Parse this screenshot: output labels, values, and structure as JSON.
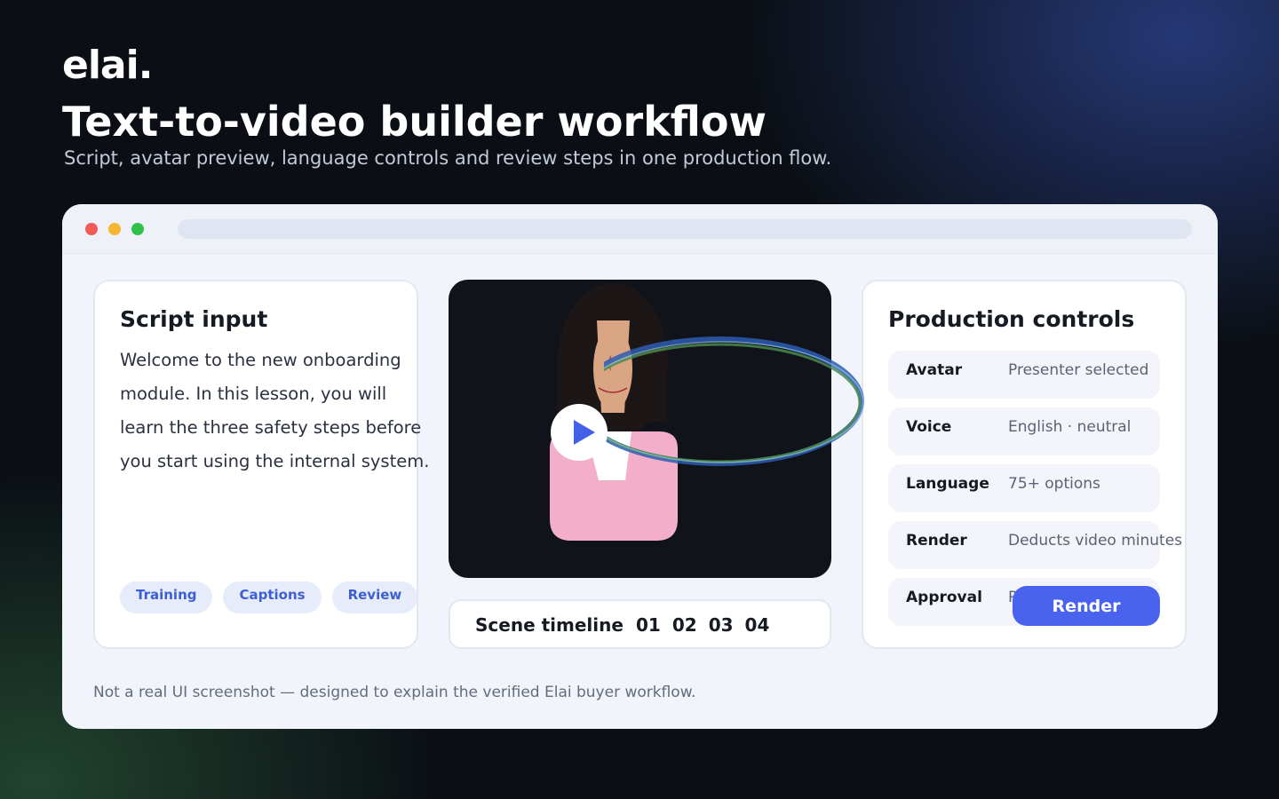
{
  "brand": {
    "logo_text": "elai."
  },
  "header": {
    "title": "Text-to-video builder workflow",
    "subtitle": "Script, avatar preview, language controls and review steps in one production flow."
  },
  "script_panel": {
    "title": "Script input",
    "lines": [
      "Welcome to the new onboarding",
      "module. In this lesson, you will",
      "learn the three safety steps before",
      "you start using the internal system."
    ],
    "tags": [
      "Training",
      "Captions",
      "Review"
    ]
  },
  "preview": {
    "avatar_icon": "presenter-avatar",
    "play_icon": "play-icon",
    "colors": {
      "background": "#10131a",
      "shirt": "#f3afc9",
      "hair": "#1c1616",
      "skin": "#d9a583",
      "play": "#4360e8"
    }
  },
  "timeline": {
    "label": "Scene timeline",
    "steps": [
      "01",
      "02",
      "03",
      "04"
    ]
  },
  "controls_panel": {
    "title": "Production controls",
    "rows": [
      {
        "label": "Avatar",
        "value": "Presenter selected"
      },
      {
        "label": "Voice",
        "value": "English · neutral"
      },
      {
        "label": "Language",
        "value": "75+ options"
      },
      {
        "label": "Render",
        "value": "Deducts video minutes"
      },
      {
        "label": "Approval",
        "value": "R                            rt"
      }
    ],
    "render_button": "Render"
  },
  "footnote": "Not a real UI screenshot — designed to explain the verified Elai buyer workflow.",
  "theme": {
    "accent": "#4a63ee",
    "tag_text": "#3e5fd4",
    "tag_bg": "#e7ecfa"
  }
}
